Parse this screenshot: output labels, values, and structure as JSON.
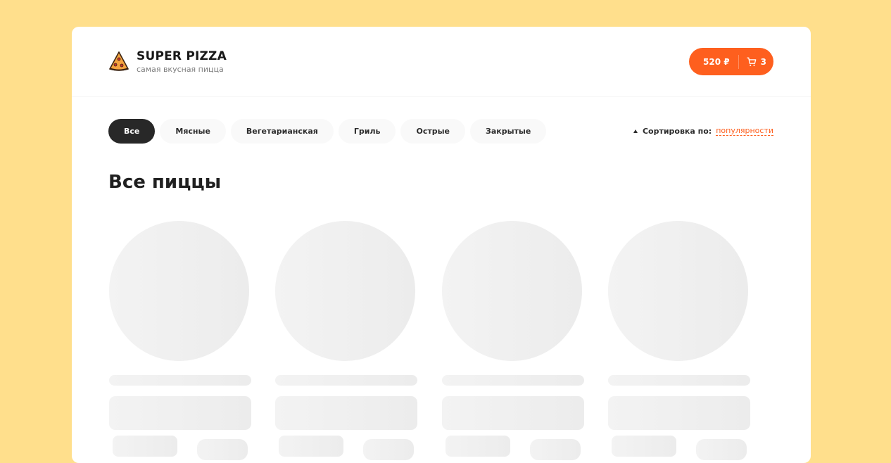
{
  "header": {
    "logo_title": "SUPER PIZZA",
    "logo_subtitle": "самая вкусная пицца",
    "logo_icon": "pizza-slice-icon",
    "cart": {
      "price": "520 ₽",
      "count": "3",
      "icon": "cart-icon",
      "color": "#FE5F1E"
    }
  },
  "categories": {
    "items": [
      "Все",
      "Мясные",
      "Вегетарианская",
      "Гриль",
      "Острые",
      "Закрытые"
    ],
    "active": "Все"
  },
  "sort": {
    "label": "Сортировка по:",
    "value": "популярности"
  },
  "main": {
    "title": "Все пиццы",
    "skeleton_cards": 4
  },
  "colors": {
    "background": "#FFDF8C",
    "accent": "#FE5F1E",
    "active_category": "#282828"
  }
}
